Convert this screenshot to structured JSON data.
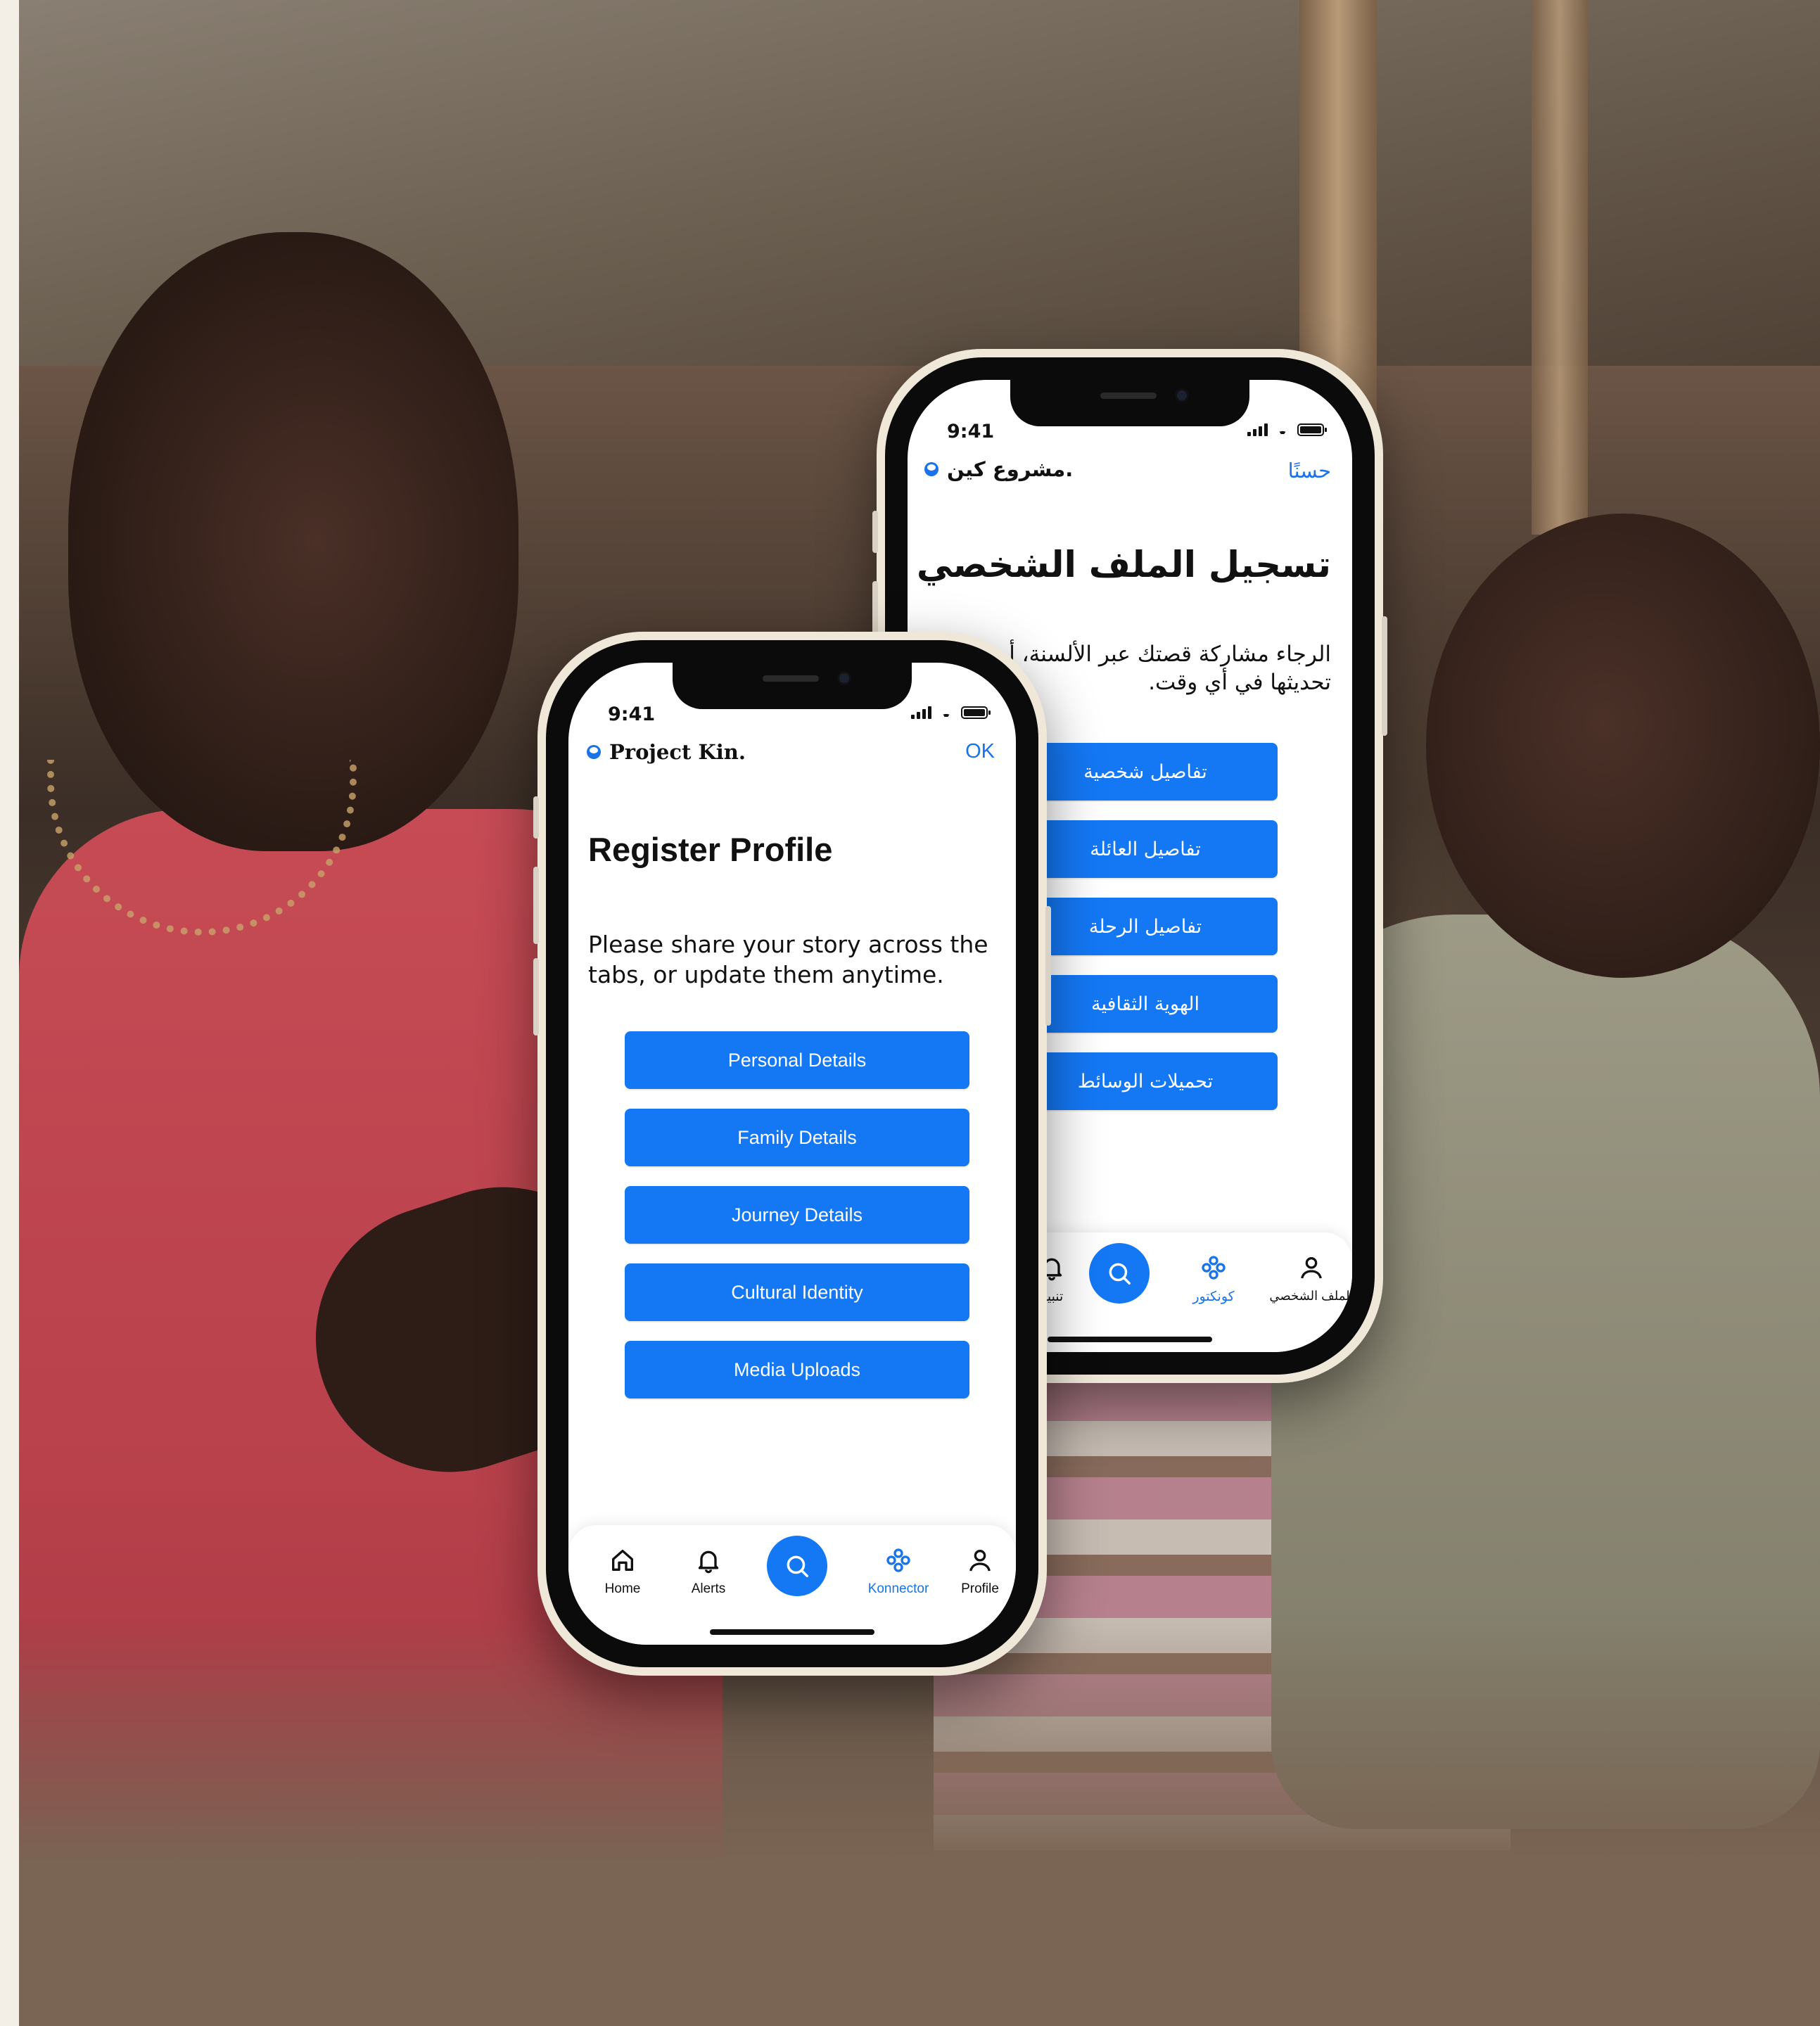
{
  "front_phone": {
    "status_time": "9:41",
    "brand": "Project Kin.",
    "ok_label": "OK",
    "title": "Register Profile",
    "description": "Please share your story across the tabs, or update them anytime.",
    "menu": [
      "Personal Details",
      "Family Details",
      "Journey Details",
      "Cultural Identity",
      "Media Uploads"
    ],
    "tabs": [
      {
        "label": "Home",
        "icon": "home-icon"
      },
      {
        "label": "Alerts",
        "icon": "bell-icon"
      },
      {
        "label": "",
        "icon": "search-icon"
      },
      {
        "label": "Konnector",
        "icon": "konnector-icon"
      },
      {
        "label": "Profile",
        "icon": "profile-icon"
      }
    ]
  },
  "back_phone": {
    "status_time": "9:41",
    "brand": "مشروع كين.",
    "ok_label": "حسنًا",
    "title": "تسجيل الملف الشخصي",
    "description": "الرجاء مشاركة قصتك عبر الألسنة، أو تحديثها في أي وقت.",
    "menu": [
      "تفاصيل شخصية",
      "تفاصيل العائلة",
      "تفاصيل الرحلة",
      "الهوية الثقافية",
      "تحميلات الوسائط"
    ],
    "tabs": [
      {
        "label": "تنبيه",
        "icon": "bell-icon"
      },
      {
        "label": "",
        "icon": "search-icon"
      },
      {
        "label": "كونكتور",
        "icon": "konnector-icon"
      },
      {
        "label": "الملف الشخصي",
        "icon": "profile-icon"
      }
    ]
  },
  "colors": {
    "accent": "#1478f5",
    "link": "#1a73e8",
    "page_background": "#f3efe6",
    "phone_frame": "#efe7d8"
  }
}
